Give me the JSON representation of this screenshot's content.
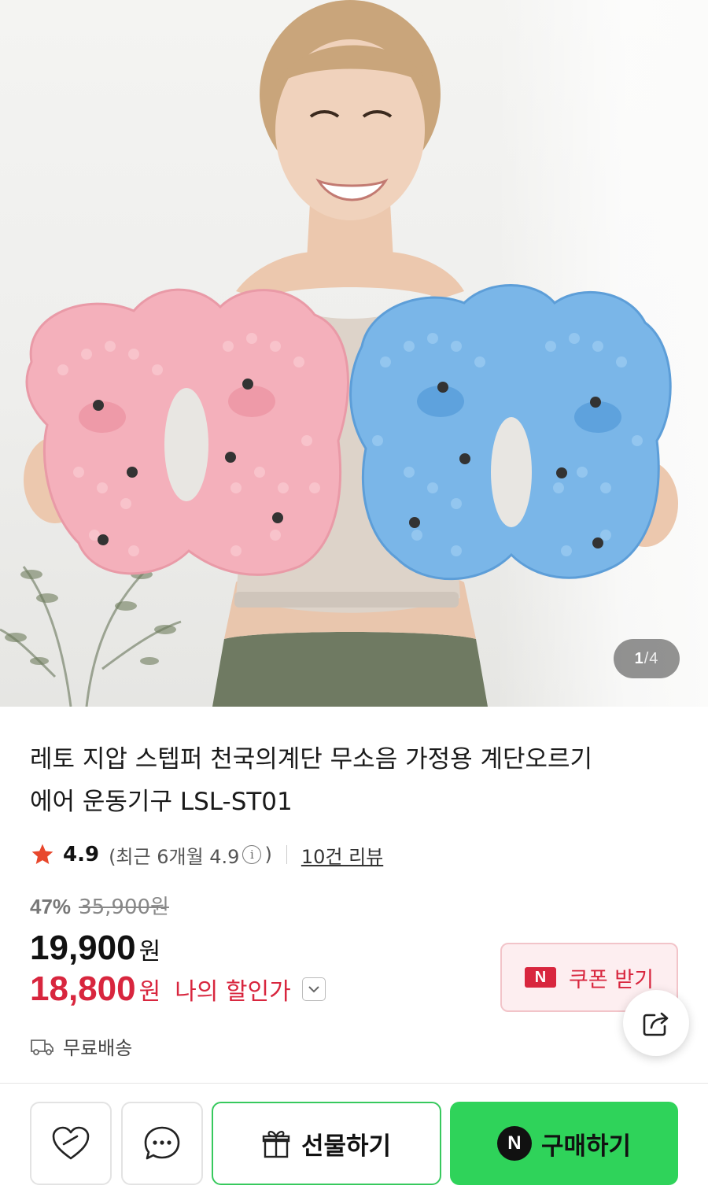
{
  "pager": {
    "current": "1",
    "separator": "/",
    "total": "4"
  },
  "product": {
    "title_line1": "레토 지압 스텝퍼 천국의계단 무소음 가정용 계단오르기",
    "title_line2": "에어 운동기구 LSL-ST01"
  },
  "rating": {
    "score": "4.9",
    "recent_prefix": "(최근 6개월 4.9",
    "recent_suffix": ")",
    "info_glyph": "i",
    "review_link": "10건 리뷰"
  },
  "price": {
    "discount_pct": "47%",
    "original": "35,900원",
    "sale": "19,900",
    "sale_unit": "원",
    "my_price": "18,800",
    "my_price_unit": "원",
    "my_price_label": "나의 할인가"
  },
  "coupon": {
    "badge": "N",
    "label": "쿠폰 받기"
  },
  "shipping": {
    "label": "무료배송"
  },
  "bottom_bar": {
    "gift_label": "선물하기",
    "buy_badge": "N",
    "buy_label": "구매하기"
  },
  "colors": {
    "accent_red": "#d8263e",
    "naver_green": "#2fd35a",
    "pink_mat": "#f2a7b3",
    "blue_mat": "#7ab6e8"
  },
  "icons": [
    "star-icon",
    "info-icon",
    "chevron-down-icon",
    "share-icon",
    "truck-icon",
    "heart-icon",
    "chat-icon",
    "gift-icon"
  ]
}
